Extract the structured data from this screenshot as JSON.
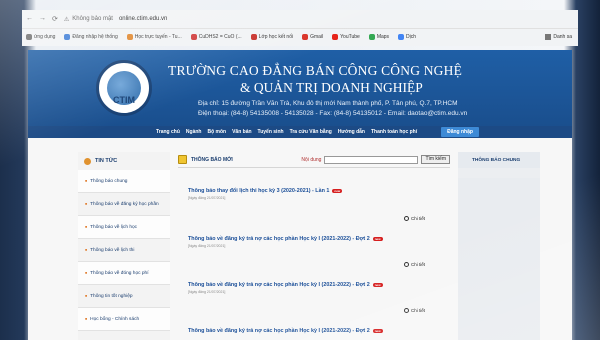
{
  "browser": {
    "security_label": "Không bảo mật",
    "url": "online.ctim.edu.vn",
    "bookmarks": [
      {
        "label": "ứng dụng",
        "color": "#6d6d6d"
      },
      {
        "label": "Đăng nhập hệ thống",
        "color": "#3b7bd6"
      },
      {
        "label": "Học trực tuyến - Tu...",
        "color": "#e0862b"
      },
      {
        "label": "CuDHS2 = CuO (...",
        "color": "#d03a3a"
      },
      {
        "label": "Lớp học kết nối",
        "color": "#c8312b"
      },
      {
        "label": "Gmail",
        "color": "#d93025"
      },
      {
        "label": "YouTube",
        "color": "#e62117"
      },
      {
        "label": "Maps",
        "color": "#34a853"
      },
      {
        "label": "Dịch",
        "color": "#4285f4"
      }
    ],
    "right_bookmark": "Danh sa"
  },
  "header": {
    "logo_text": "CTIM",
    "school_line1": "TRƯỜNG CAO ĐẲNG BÁN CÔNG CÔNG NGHỆ",
    "school_line2": "& QUẢN TRỊ DOANH NGHIỆP",
    "address": "Địa chỉ: 15 đường Trần Văn Trà, Khu đô thị mới Nam thành phố, P. Tân phú, Q.7, TP.HCM",
    "contact": "Điện thoại: (84-8) 54135008 - 54135028 - Fax: (84-8) 54135012 - Email: daotao@ctim.edu.vn"
  },
  "menu": {
    "items": [
      "Trang chủ",
      "Ngành",
      "Bộ môn",
      "Văn bản",
      "Tuyển sinh",
      "Tra cứu Văn bằng",
      "Hướng dẫn",
      "Thanh toán học phí"
    ],
    "login": "Đăng nhập"
  },
  "sidebar": {
    "heading": "TIN TỨC",
    "items": [
      "Thông báo chung",
      "Thông báo về đăng ký học phần",
      "Thông báo về lịch học",
      "Thông báo về lịch thi",
      "Thông báo về đóng học phí",
      "Thông tin tốt nghiệp",
      "Học bổng - Chính sách"
    ]
  },
  "main": {
    "heading": "THÔNG BÁO MỚI",
    "search_label": "Nội dung",
    "search_value": "",
    "search_button": "Tìm kiếm",
    "news": [
      {
        "title": "Thông báo thay đổi lịch thi học kỳ 3 (2020-2021) - Lần 1",
        "date": "[Ngày đăng 21/07/2021]",
        "detail": "Chi tiết"
      },
      {
        "title": "Thông báo về đăng ký trả nợ các học phần Học kỳ I (2021-2022) - Đợt 2",
        "date": "[Ngày đăng 21/07/2021]",
        "detail": "Chi tiết"
      },
      {
        "title": "Thông báo về đăng ký trả nợ các học phần Học kỳ I (2021-2022) - Đợt 2",
        "date": "[Ngày đăng 21/07/2021]",
        "detail": "Chi tiết"
      },
      {
        "title": "Thông báo về đăng ký trả nợ các học phần Học kỳ I (2021-2022) - Đợt 2",
        "date": "",
        "detail": ""
      }
    ],
    "new_badge": "new"
  },
  "right": {
    "heading": "THÔNG BÁO CHUNG"
  }
}
